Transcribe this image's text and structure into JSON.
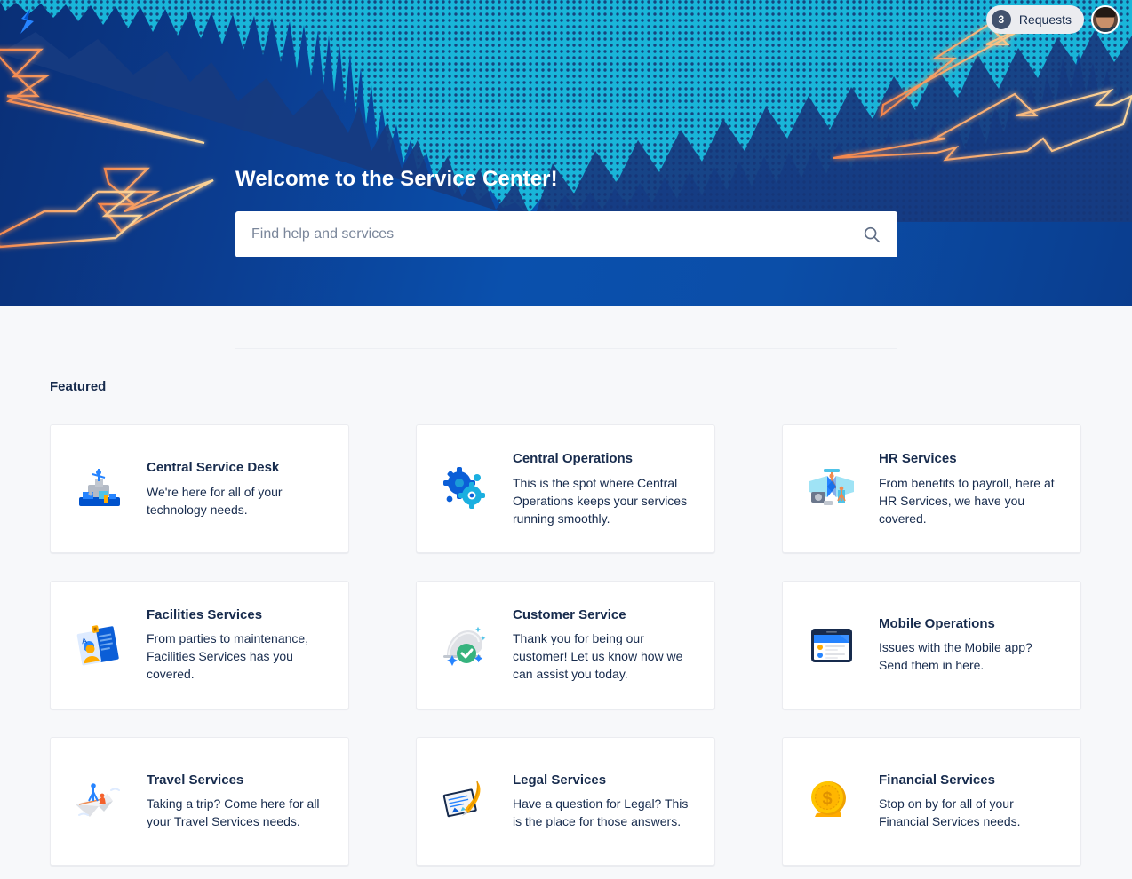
{
  "brand": {
    "logo_icon": "lightning-bolt-logo",
    "accent_blue": "#0052CC",
    "hero_blue": "#0a50ad",
    "cyan": "#19B5D9",
    "bolt_orange": "#F5A05A"
  },
  "topbar": {
    "requests_count": "3",
    "requests_label": "Requests",
    "avatar_icon": "user-avatar"
  },
  "hero": {
    "title": "Welcome to the Service Center!",
    "search_placeholder": "Find help and services",
    "search_value": "",
    "search_icon": "search-icon"
  },
  "featured": {
    "heading": "Featured",
    "cards": [
      {
        "icon": "service-desk-icon",
        "title": "Central Service Desk",
        "desc": "We're here for all of your technology needs."
      },
      {
        "icon": "gears-icon",
        "title": "Central Operations",
        "desc": "This is the spot where Central Operations keeps your services running smoothly."
      },
      {
        "icon": "hr-people-icon",
        "title": "HR Services",
        "desc": "From benefits to payroll, here at HR Services, we have you covered."
      },
      {
        "icon": "id-badge-icon",
        "title": "Facilities Services",
        "desc": "From parties to maintenance, Facilities Services has you covered."
      },
      {
        "icon": "service-dome-check-icon",
        "title": "Customer Service",
        "desc": "Thank you for being our customer! Let us know how we can assist you today."
      },
      {
        "icon": "tablet-device-icon",
        "title": "Mobile Operations",
        "desc": "Issues with the Mobile app? Send them in here."
      },
      {
        "icon": "paper-plane-icon",
        "title": "Travel Services",
        "desc": "Taking a trip? Come here for all your Travel Services needs."
      },
      {
        "icon": "document-quill-icon",
        "title": "Legal Services",
        "desc": "Have a question for Legal? This is the place for those answers."
      },
      {
        "icon": "gold-coin-icon",
        "title": "Financial Services",
        "desc": "Stop on by for all of your Financial Services needs."
      }
    ]
  }
}
